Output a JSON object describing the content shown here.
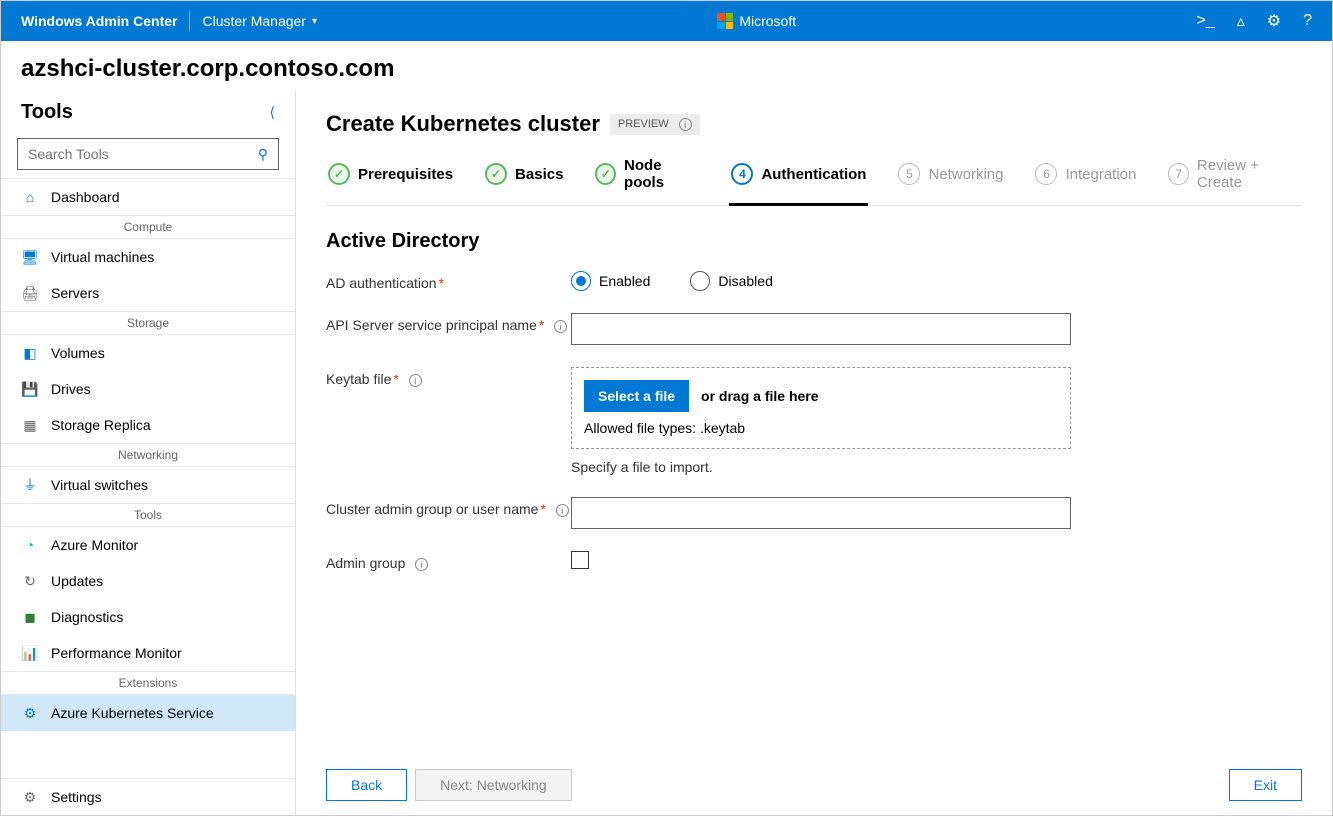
{
  "topbar": {
    "app_name": "Windows Admin Center",
    "breadcrumb": "Cluster Manager",
    "brand": "Microsoft"
  },
  "cluster_title": "azshci-cluster.corp.contoso.com",
  "sidebar": {
    "title": "Tools",
    "search_placeholder": "Search Tools",
    "items": [
      {
        "label": "Dashboard"
      },
      {
        "group": "Compute"
      },
      {
        "label": "Virtual machines"
      },
      {
        "label": "Servers"
      },
      {
        "group": "Storage"
      },
      {
        "label": "Volumes"
      },
      {
        "label": "Drives"
      },
      {
        "label": "Storage Replica"
      },
      {
        "group": "Networking"
      },
      {
        "label": "Virtual switches"
      },
      {
        "group": "Tools"
      },
      {
        "label": "Azure Monitor"
      },
      {
        "label": "Updates"
      },
      {
        "label": "Diagnostics"
      },
      {
        "label": "Performance Monitor"
      },
      {
        "group": "Extensions"
      },
      {
        "label": "Azure Kubernetes Service",
        "selected": true
      }
    ],
    "settings_label": "Settings"
  },
  "page": {
    "title": "Create Kubernetes cluster",
    "badge": "PREVIEW"
  },
  "wizard": {
    "steps": [
      {
        "label": "Prerequisites",
        "state": "done"
      },
      {
        "label": "Basics",
        "state": "done"
      },
      {
        "label": "Node pools",
        "state": "done"
      },
      {
        "label": "Authentication",
        "state": "active",
        "num": "4"
      },
      {
        "label": "Networking",
        "state": "pending",
        "num": "5"
      },
      {
        "label": "Integration",
        "state": "pending",
        "num": "6"
      },
      {
        "label": "Review + Create",
        "state": "pending",
        "num": "7"
      }
    ]
  },
  "form": {
    "section_title": "Active Directory",
    "ad_auth_label": "AD authentication",
    "enabled_label": "Enabled",
    "disabled_label": "Disabled",
    "api_label": "API Server service principal name",
    "keytab_label": "Keytab file",
    "select_file_btn": "Select a file",
    "drag_text": "or drag a file here",
    "allowed_text": "Allowed file types: .keytab",
    "helper_text": "Specify a file to import.",
    "admin_group_user_label": "Cluster admin group or user name",
    "admin_group_label": "Admin group"
  },
  "footer": {
    "back": "Back",
    "next": "Next: Networking",
    "exit": "Exit"
  }
}
